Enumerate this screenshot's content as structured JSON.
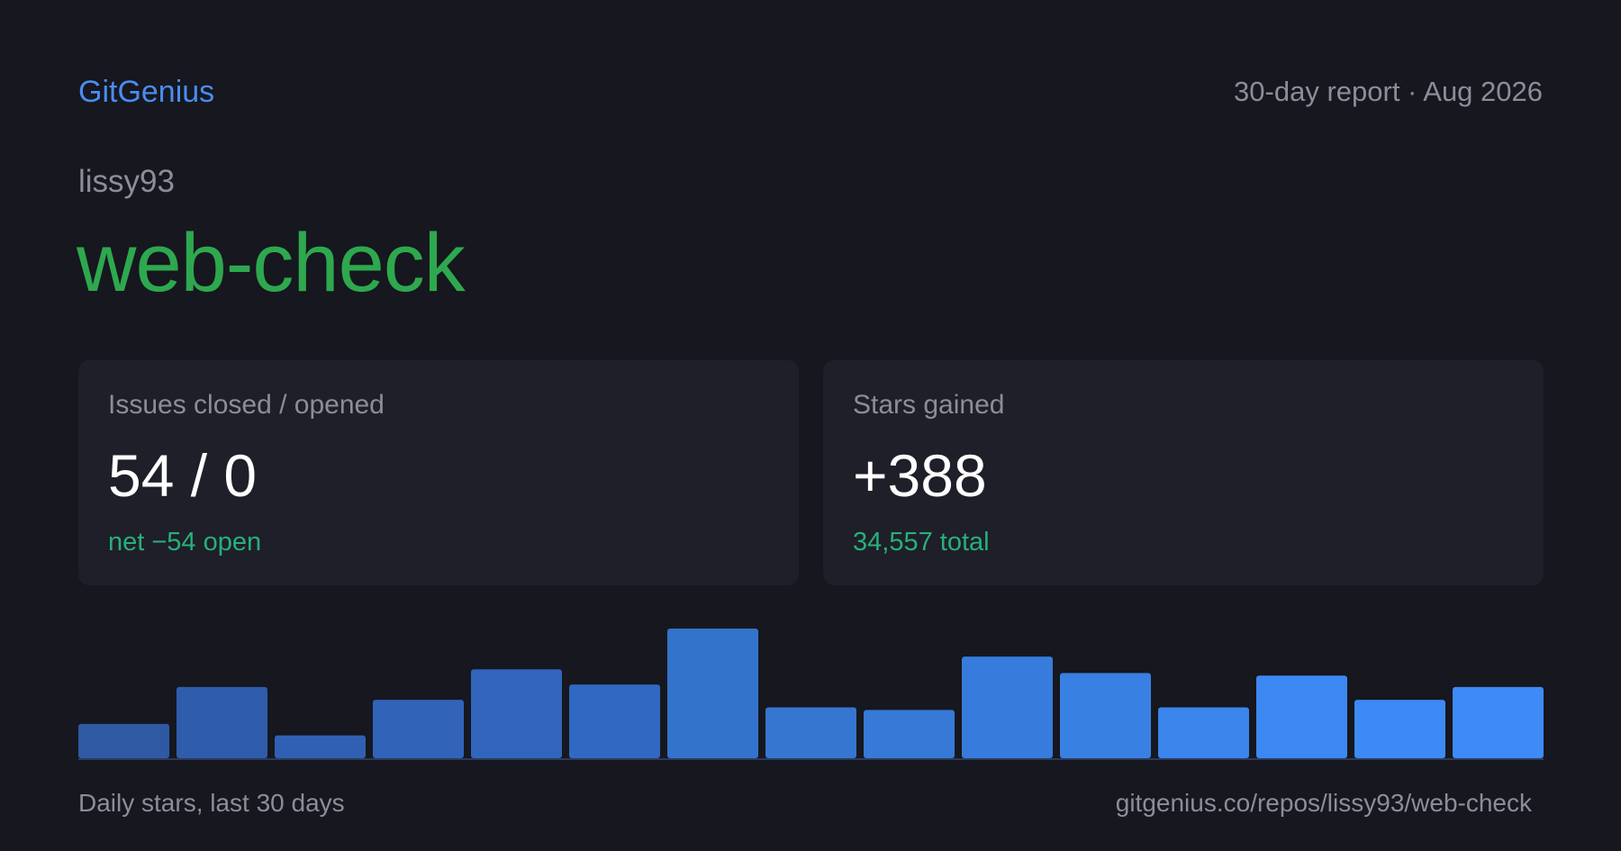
{
  "header": {
    "brand": "GitGenius",
    "report_label": "30-day report · Aug 2026"
  },
  "repo": {
    "owner": "lissy93",
    "name": "web-check"
  },
  "cards": {
    "issues": {
      "label": "Issues closed / opened",
      "value": "54 / 0",
      "sub": "net −54 open"
    },
    "stars": {
      "label": "Stars gained",
      "value": "+388",
      "sub": "34,557 total"
    }
  },
  "footer": {
    "caption": "Daily stars, last 30 days",
    "url": "gitgenius.co/repos/lissy93/web-check"
  },
  "colors": {
    "background": "#16171f",
    "card": "#1e1f29",
    "brand": "#4a8cf0",
    "repo_name": "#2ea84e",
    "positive": "#27b07a",
    "muted": "#8b8e99"
  },
  "chart_data": {
    "type": "bar",
    "title": "",
    "xlabel": "",
    "ylabel": "",
    "values": [
      27,
      56,
      18,
      46,
      70,
      58,
      102,
      40,
      38,
      80,
      67,
      40,
      65,
      46,
      56
    ],
    "ylim": [
      0,
      102
    ],
    "colors": [
      "#2f5aa3",
      "#2f5cab",
      "#3060b3",
      "#3163b8",
      "#3165bc",
      "#3168c1",
      "#3473cb",
      "#3676d1",
      "#3679d7",
      "#377cdc",
      "#3980e3",
      "#3b85ec",
      "#3d88f2",
      "#3d89f5",
      "#3e8af7"
    ]
  }
}
